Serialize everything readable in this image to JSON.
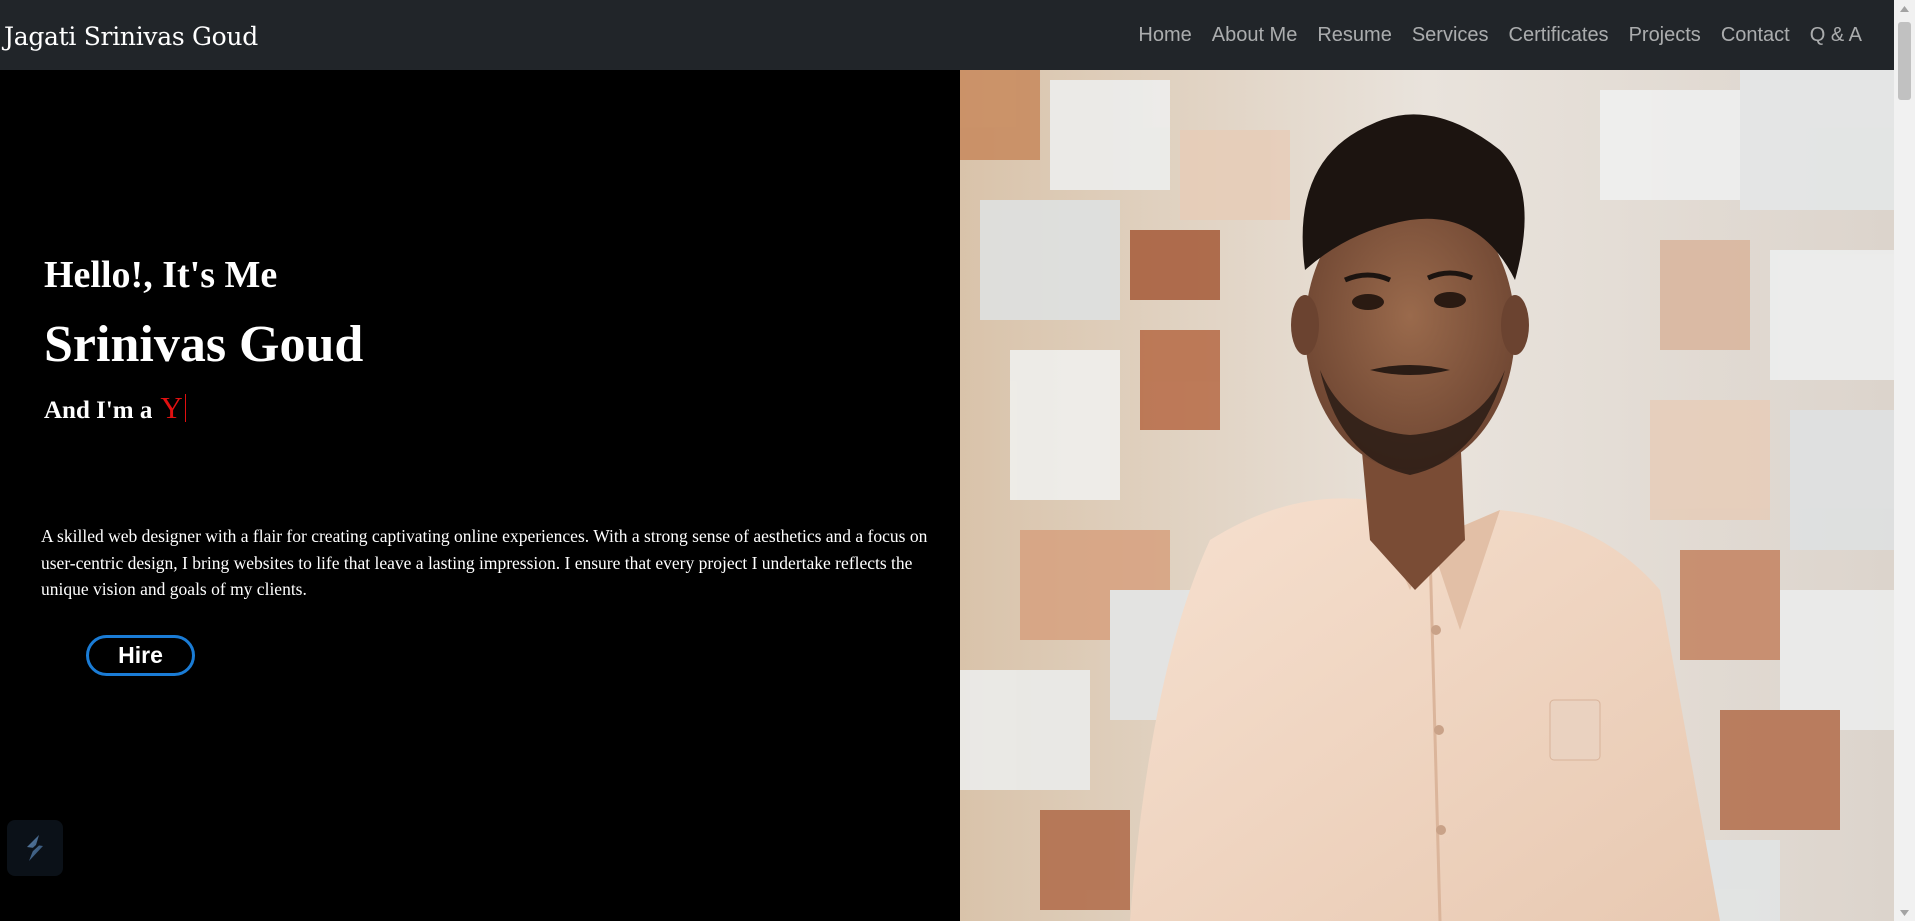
{
  "navbar": {
    "brand": "Jagati Srinivas Goud",
    "links": [
      "Home",
      "About Me",
      "Resume",
      "Services",
      "Certificates",
      "Projects",
      "Contact",
      "Q & A"
    ]
  },
  "hero": {
    "greeting": "Hello!, It's Me",
    "name": "Srinivas Goud",
    "role_prefix": "And I'm a",
    "typed_text": "Y",
    "description": "A skilled web designer with a flair for creating captivating online experiences. With a strong sense of aesthetics and a focus on user-centric design, I bring websites to life that leave a lasting impression. I ensure that every project I undertake reflects the unique vision and goals of my clients.",
    "hire_label": "Hire"
  },
  "colors": {
    "navbar_bg": "#212529",
    "accent_red": "#e01010",
    "button_border": "#1a7cd6"
  },
  "icons": {
    "floating_widget": "lightning-bolt-icon",
    "scroll_up": "arrow-up-icon",
    "scroll_down": "arrow-down-icon"
  }
}
